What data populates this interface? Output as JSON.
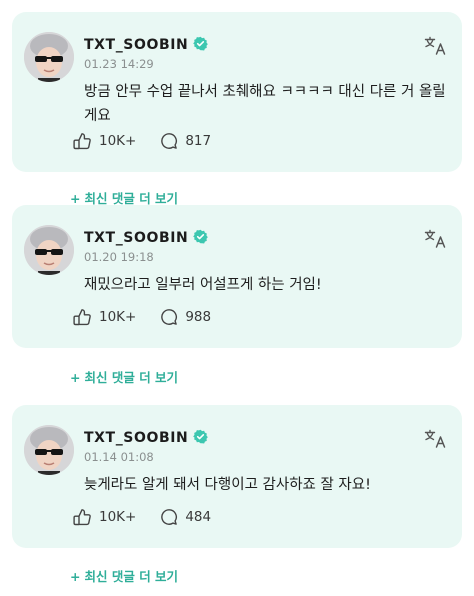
{
  "posts": [
    {
      "username": "TXT_SOOBIN",
      "timestamp": "01.23 14:29",
      "message": "방금 안무 수업 끝나서 초췌해요 ㅋㅋㅋㅋ 대신 다른 거 올릴게요",
      "likes": "10K+",
      "comments": "817",
      "more_comments": "최신 댓글 더 보기"
    },
    {
      "username": "TXT_SOOBIN",
      "timestamp": "01.20 19:18",
      "message": "재밌으라고 일부러 어설프게 하는 거임!",
      "likes": "10K+",
      "comments": "988",
      "more_comments": "최신 댓글 더 보기"
    },
    {
      "username": "TXT_SOOBIN",
      "timestamp": "01.14 01:08",
      "message": "늦게라도 알게 돼서 다행이고 감사하죠 잘 자요!",
      "likes": "10K+",
      "comments": "484",
      "more_comments": "최신 댓글 더 보기"
    }
  ],
  "icons": {
    "verified": "verified-badge-icon",
    "translate": "translate-icon",
    "like": "like-icon",
    "comment": "comment-bubble-icon",
    "plus": "plus-icon"
  },
  "colors": {
    "card_background": "#e9f8f4",
    "accent": "#2fae99",
    "verified": "#3cc7b0",
    "timestamp": "#8a8f8f"
  }
}
